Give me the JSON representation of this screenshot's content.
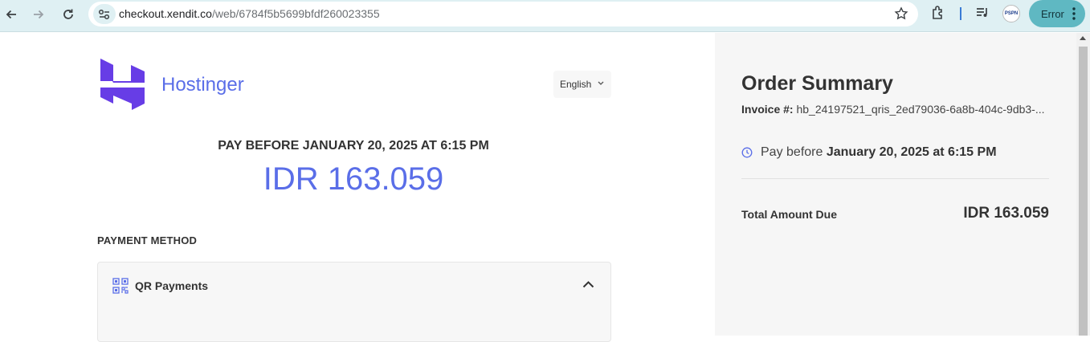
{
  "browser": {
    "url_host": "checkout.xendit.co",
    "url_path": "/web/6784f5b5699bfdf260023355",
    "profile_text": "PSPN",
    "error_label": "Error"
  },
  "merchant": {
    "name": "Hostinger",
    "brand_color": "#673de6"
  },
  "language": {
    "selected": "English"
  },
  "payment": {
    "pay_before": "PAY BEFORE JANUARY 20, 2025 AT 6:15 PM",
    "amount": "IDR 163.059",
    "method_heading": "PAYMENT METHOD",
    "method_label": "QR Payments"
  },
  "summary": {
    "title": "Order Summary",
    "invoice_label": "Invoice #:",
    "invoice_value": "hb_24197521_qris_2ed79036-6a8b-404c-9db3-...",
    "pay_before_prefix": "Pay before",
    "pay_before_date": "January 20, 2025 at 6:15 PM",
    "total_label": "Total Amount Due",
    "total_value": "IDR 163.059"
  },
  "colors": {
    "accent": "#5a6ee8",
    "toolbar": "#dff0f3",
    "error_pill": "#5fb8c2"
  }
}
